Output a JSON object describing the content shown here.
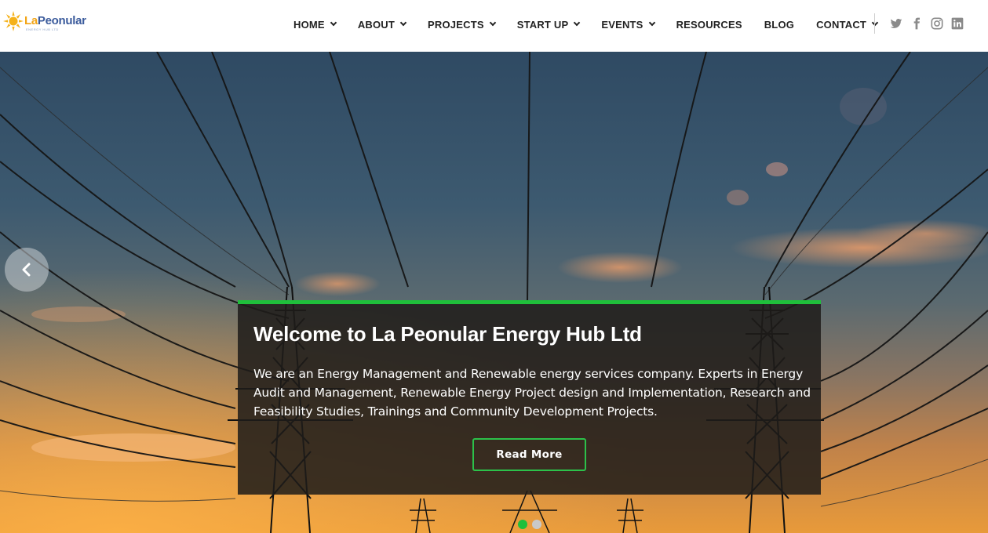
{
  "brand": {
    "name_part1": "La",
    "name_part2": "Peonular",
    "tagline": "ENERGY HUB LTD"
  },
  "nav": {
    "items": [
      {
        "label": "HOME",
        "dropdown": true
      },
      {
        "label": "ABOUT",
        "dropdown": true
      },
      {
        "label": "PROJECTS",
        "dropdown": true
      },
      {
        "label": "START UP",
        "dropdown": true
      },
      {
        "label": "EVENTS",
        "dropdown": true
      },
      {
        "label": "RESOURCES",
        "dropdown": false
      },
      {
        "label": "BLOG",
        "dropdown": false
      },
      {
        "label": "CONTACT",
        "dropdown": true
      }
    ]
  },
  "socials": [
    "twitter-icon",
    "facebook-icon",
    "instagram-icon",
    "linkedin-icon"
  ],
  "slider": {
    "title": "Welcome to La Peonular Energy Hub Ltd",
    "text": "We are an Energy Management and Renewable energy services company. Experts in Energy Audit and Management, Renewable Energy Project design and Implementation, Research and Feasibility Studies, Trainings and Community Development Projects.",
    "button_label": "Read More",
    "slide_count": 2,
    "active_slide": 1
  },
  "colors": {
    "accent_green": "#1fbf3b",
    "brand_orange": "#f2a416",
    "brand_blue": "#3b5b9c",
    "nav_text": "#222222"
  }
}
